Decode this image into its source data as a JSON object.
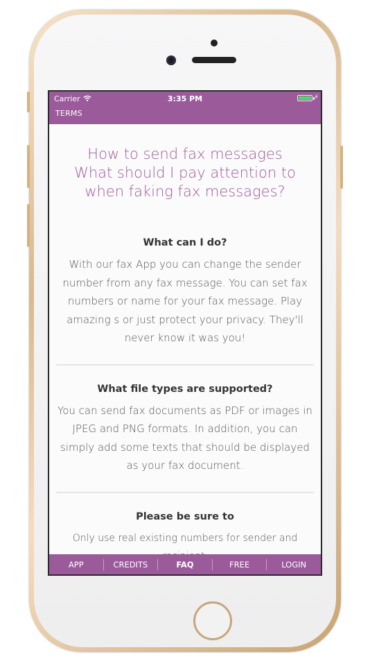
{
  "status": {
    "carrier": "Carrier",
    "time": "3:35 PM",
    "wifi_icon": "wifi-icon",
    "battery_icon": "battery-icon",
    "battery_color": "#4cd964"
  },
  "header": {
    "terms_label": "TERMS",
    "color": "#9b5b9b"
  },
  "title": {
    "line1": "How to send fax messages",
    "line2": "What should I pay attention to when faking fax messages?",
    "color": "#a05aa0"
  },
  "faq": [
    {
      "question": "What can I do?",
      "answer": "With our fax App you can change the sender number from any fax message. You can set fax numbers or name for your fax message. Play amazing s or just protect your privacy. They'll never know it was you!"
    },
    {
      "question": "What file types are supported?",
      "answer": "You can send fax documents as PDF or images in JPEG and PNG formats. In addition, you can simply add some texts that should be displayed as your fax document."
    },
    {
      "question": "Please be sure to",
      "answer": "Only use real existing numbers for sender and recipient."
    }
  ],
  "nav": [
    {
      "label": "APP",
      "active": false
    },
    {
      "label": "CREDITS",
      "active": false
    },
    {
      "label": "FAQ",
      "active": true
    },
    {
      "label": "FREE",
      "active": false
    },
    {
      "label": "LOGIN",
      "active": false
    }
  ]
}
